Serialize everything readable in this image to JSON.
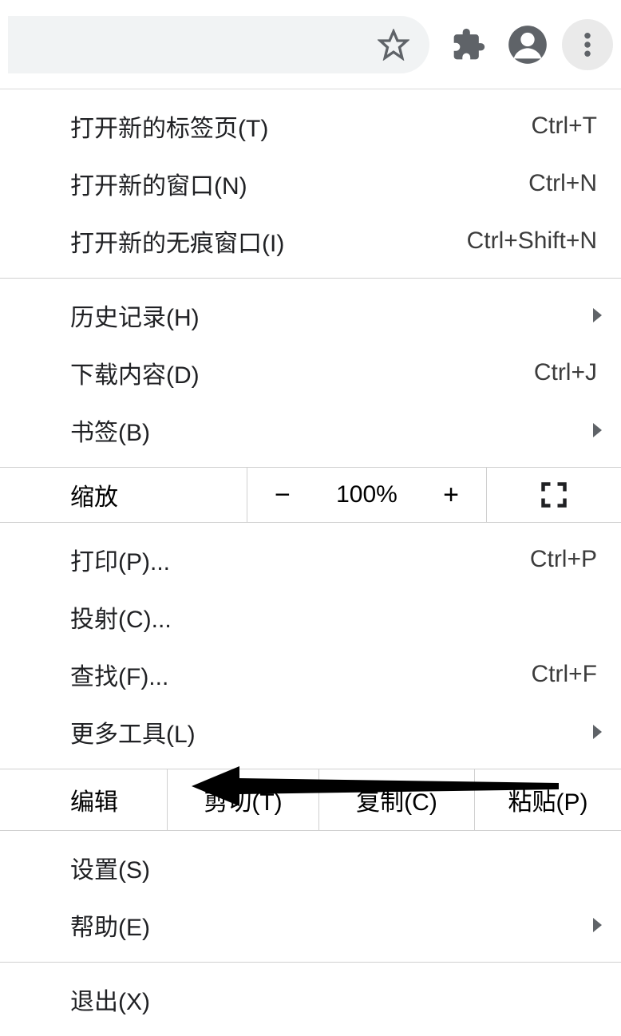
{
  "toolbar": {
    "star_icon_name": "star-icon",
    "extensions_icon_name": "puzzle-icon",
    "profile_icon_name": "profile-icon",
    "more_icon_name": "kebab-icon"
  },
  "menu": {
    "open": {
      "new_tab": {
        "label": "打开新的标签页(T)",
        "shortcut": "Ctrl+T"
      },
      "new_window": {
        "label": "打开新的窗口(N)",
        "shortcut": "Ctrl+N"
      },
      "new_incognito": {
        "label": "打开新的无痕窗口(I)",
        "shortcut": "Ctrl+Shift+N"
      }
    },
    "history": {
      "label": "历史记录(H)"
    },
    "downloads": {
      "label": "下载内容(D)",
      "shortcut": "Ctrl+J"
    },
    "bookmarks": {
      "label": "书签(B)"
    },
    "zoom": {
      "label": "缩放",
      "minus": "−",
      "value": "100%",
      "plus": "+"
    },
    "print": {
      "label": "打印(P)...",
      "shortcut": "Ctrl+P"
    },
    "cast": {
      "label": "投射(C)..."
    },
    "find": {
      "label": "查找(F)...",
      "shortcut": "Ctrl+F"
    },
    "more_tools": {
      "label": "更多工具(L)"
    },
    "edit": {
      "label": "编辑",
      "cut": "剪切(T)",
      "copy": "复制(C)",
      "paste": "粘贴(P)"
    },
    "settings": {
      "label": "设置(S)"
    },
    "help": {
      "label": "帮助(E)"
    },
    "exit": {
      "label": "退出(X)"
    }
  }
}
